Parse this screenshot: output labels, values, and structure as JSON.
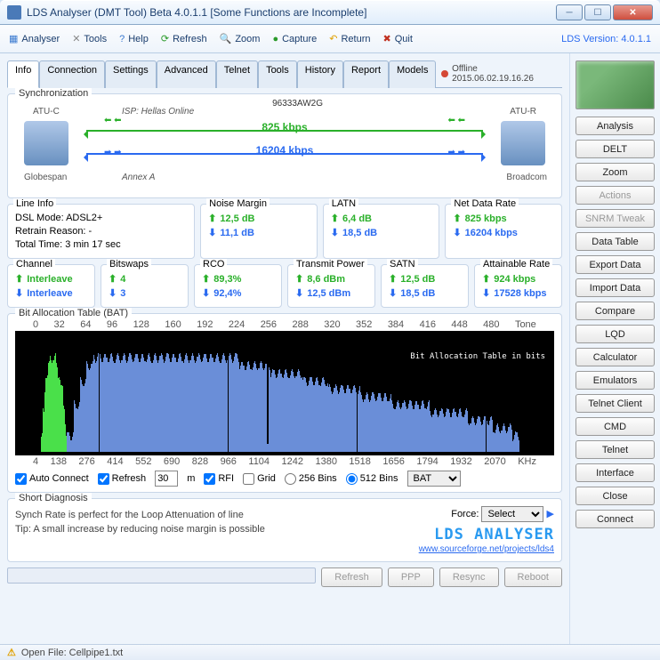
{
  "window": {
    "title": "LDS Analyser (DMT Tool) Beta 4.0.1.1 [Some Functions are Incomplete]"
  },
  "toolbar": {
    "analyser": "Analyser",
    "tools": "Tools",
    "help": "Help",
    "refresh": "Refresh",
    "zoom": "Zoom",
    "capture": "Capture",
    "return": "Return",
    "quit": "Quit",
    "version": "LDS Version: 4.0.1.1"
  },
  "tabs": [
    "Info",
    "Connection",
    "Settings",
    "Advanced",
    "Telnet",
    "Tools",
    "History",
    "Report",
    "Models"
  ],
  "offline": "Offline 2015.06.02.19.16.26",
  "sync": {
    "title": "Synchronization",
    "model": "96333AW2G",
    "atuc": "ATU-C",
    "atur": "ATU-R",
    "globespan": "Globespan",
    "broadcom": "Broadcom",
    "isp": "ISP: Hellas Online",
    "annex": "Annex A",
    "up_rate": "825 kbps",
    "dn_rate": "16204 kbps"
  },
  "lineinfo": {
    "title": "Line Info",
    "l1": "DSL Mode: ADSL2+",
    "l2": "Retrain Reason: -",
    "l3": "Total Time: 3 min 17 sec"
  },
  "noise": {
    "title": "Noise Margin",
    "up": "12,5 dB",
    "dn": "11,1 dB"
  },
  "latn": {
    "title": "LATN",
    "up": "6,4 dB",
    "dn": "18,5 dB"
  },
  "netrate": {
    "title": "Net Data Rate",
    "up": "825 kbps",
    "dn": "16204 kbps"
  },
  "channel": {
    "title": "Channel",
    "up": "Interleave",
    "dn": "Interleave"
  },
  "bitswaps": {
    "title": "Bitswaps",
    "up": "4",
    "dn": "3"
  },
  "rco": {
    "title": "RCO",
    "up": "89,3%",
    "dn": "92,4%"
  },
  "txpow": {
    "title": "Transmit Power",
    "up": "8,6 dBm",
    "dn": "12,5 dBm"
  },
  "satn": {
    "title": "SATN",
    "up": "12,5 dB",
    "dn": "18,5 dB"
  },
  "attain": {
    "title": "Attainable Rate",
    "up": "924 kbps",
    "dn": "17528 kbps"
  },
  "bat": {
    "title": "Bit Allocation Table (BAT)",
    "unit_right": "Tone",
    "unit_br": "KHz",
    "label": "Bit Allocation Table in bits"
  },
  "chart_opts": {
    "auto": "Auto Connect",
    "refresh": "Refresh",
    "refresh_val": "30",
    "refresh_unit": "m",
    "rfi": "RFI",
    "grid": "Grid",
    "b256": "256 Bins",
    "b512": "512 Bins",
    "combo": "BAT"
  },
  "diag": {
    "title": "Short Diagnosis",
    "l1": "Synch Rate is perfect for the Loop Attenuation of line",
    "l2": "Tip: A small increase by reducing noise margin is possible",
    "force": "Force:",
    "select": "Select",
    "logo": "LDS ANALYSER",
    "link": "www.sourceforge.net/projects/lds4"
  },
  "btns": {
    "refresh": "Refresh",
    "ppp": "PPP",
    "resync": "Resync",
    "reboot": "Reboot"
  },
  "side": [
    "Analysis",
    "DELT",
    "Zoom",
    "Actions",
    "SNRM Tweak",
    "Data Table",
    "Export Data",
    "Import Data",
    "Compare",
    "LQD",
    "Calculator",
    "Emulators",
    "Telnet Client",
    "CMD",
    "Telnet",
    "Interface",
    "Close",
    "Connect"
  ],
  "side_disabled": [
    3,
    4
  ],
  "status": {
    "icon": "⚠",
    "text": "Open File: Cellpipe1.txt"
  },
  "chart_data": {
    "type": "bar",
    "title": "Bit Allocation Table (BAT)",
    "xlabel": "Tone",
    "ylabel": "bits",
    "ylim": [
      0,
      15
    ],
    "top_ticks": [
      0,
      32,
      64,
      96,
      128,
      160,
      192,
      224,
      256,
      288,
      320,
      352,
      384,
      416,
      448,
      480
    ],
    "bot_ticks": [
      4,
      138,
      276,
      414,
      552,
      690,
      828,
      966,
      1104,
      1242,
      1380,
      1518,
      1656,
      1794,
      1932,
      2070
    ],
    "y_ticks": [
      15,
      13,
      11,
      9,
      7,
      5,
      4
    ],
    "series": [
      {
        "name": "upstream",
        "color": "#4ae04a",
        "range": [
          6,
          31
        ],
        "profile": [
          2,
          5,
          8,
          10,
          11,
          12,
          12,
          12,
          12,
          11,
          10,
          9,
          8,
          6,
          4,
          2
        ]
      },
      {
        "name": "downstream",
        "color": "#6a8ed8",
        "range": [
          32,
          480
        ],
        "profile": [
          2,
          6,
          9,
          11,
          12,
          12,
          12,
          12,
          12,
          12,
          12,
          12,
          12,
          12,
          12,
          12,
          12,
          12,
          12,
          12,
          12,
          12,
          12,
          12,
          12,
          12,
          12,
          11,
          11,
          11,
          11,
          11,
          10,
          10,
          10,
          10,
          10,
          9,
          9,
          9,
          9,
          8,
          8,
          8,
          8,
          8,
          7,
          7,
          7,
          7,
          7,
          6,
          6,
          6,
          6,
          6,
          6,
          5,
          5,
          5,
          5,
          5,
          5,
          4,
          4,
          4,
          4,
          3,
          3,
          3,
          2,
          2
        ]
      }
    ]
  }
}
